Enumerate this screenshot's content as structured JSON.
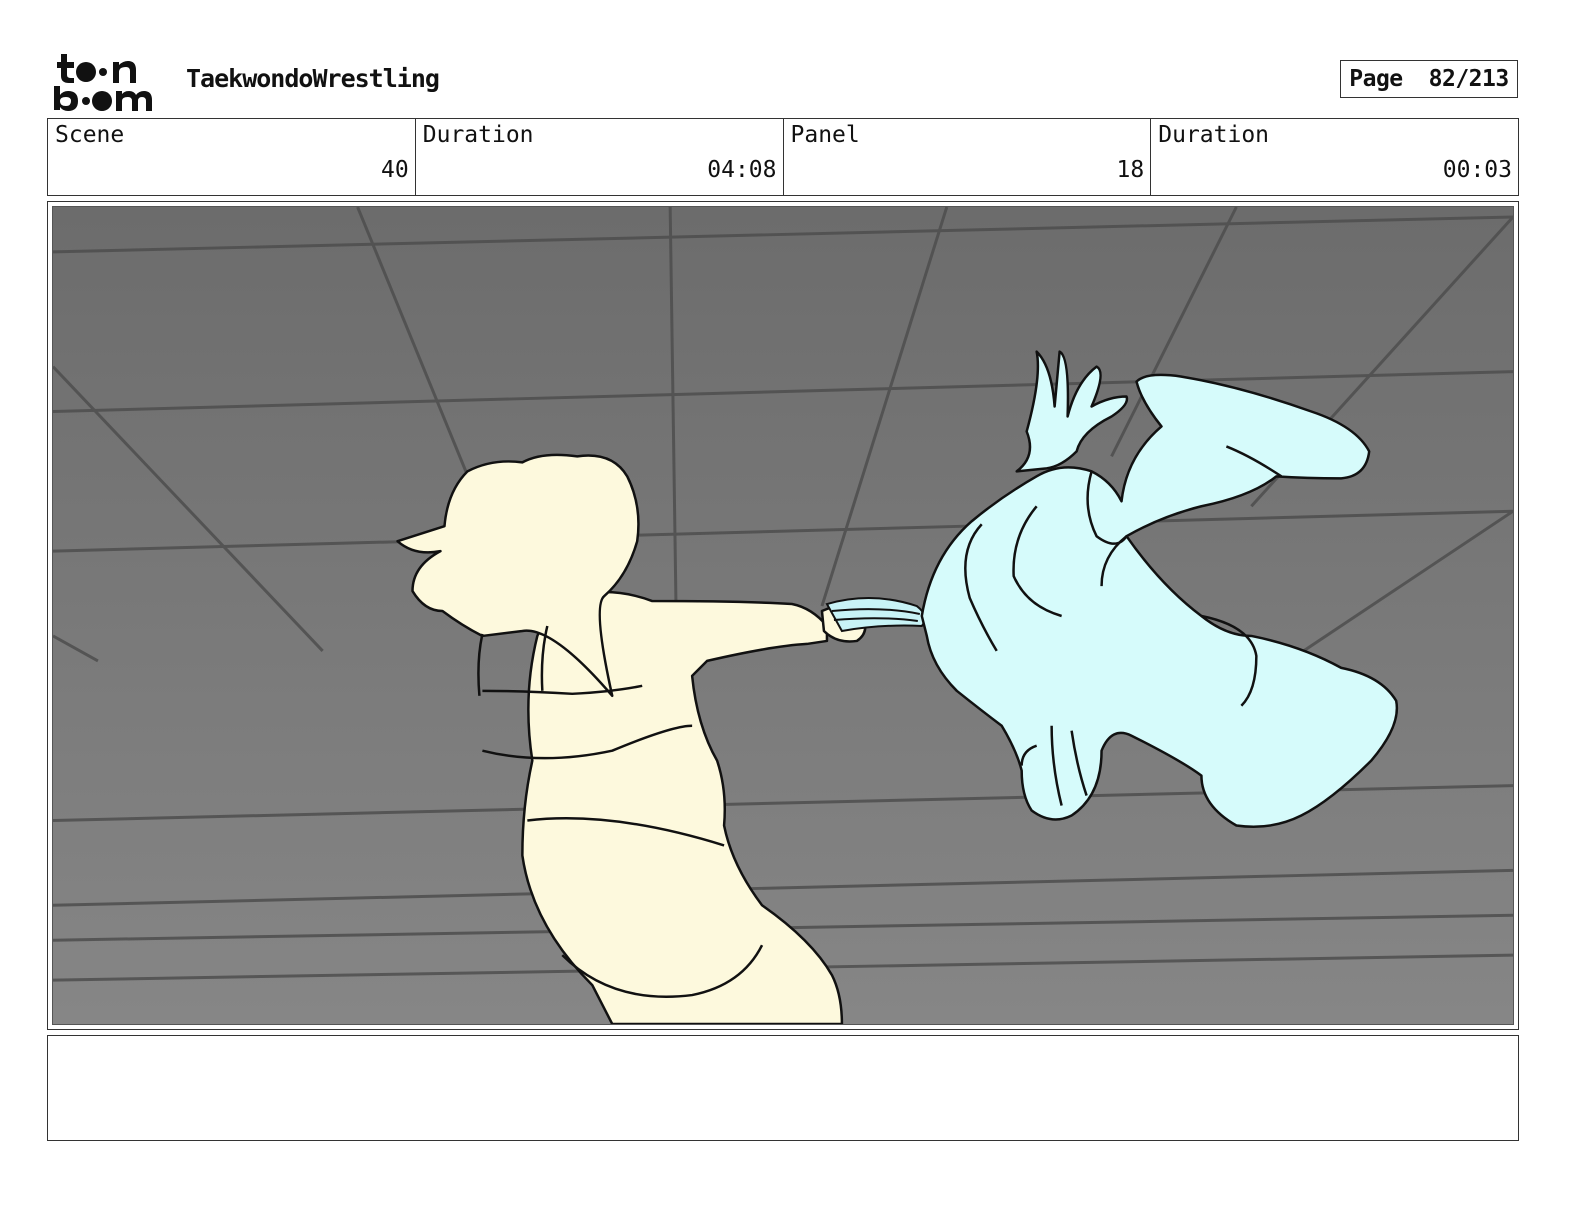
{
  "project": {
    "title": "TaekwondoWrestling"
  },
  "logo": {
    "icon": "toon-boom-logo",
    "line1": "toon",
    "line2": "boom"
  },
  "page": {
    "label": "Page",
    "value": "82/213"
  },
  "info": {
    "scene_label": "Scene",
    "scene_value": "40",
    "scene_duration_label": "Duration",
    "scene_duration_value": "04:08",
    "panel_label": "Panel",
    "panel_value": "18",
    "panel_duration_label": "Duration",
    "panel_duration_value": "00:03"
  },
  "colors": {
    "ceiling": "#6f6f6f",
    "left_figure_fill": "#fdf9dd",
    "right_figure_fill": "#d6fbfb",
    "line": "#111111"
  },
  "notes": {
    "text": ""
  }
}
